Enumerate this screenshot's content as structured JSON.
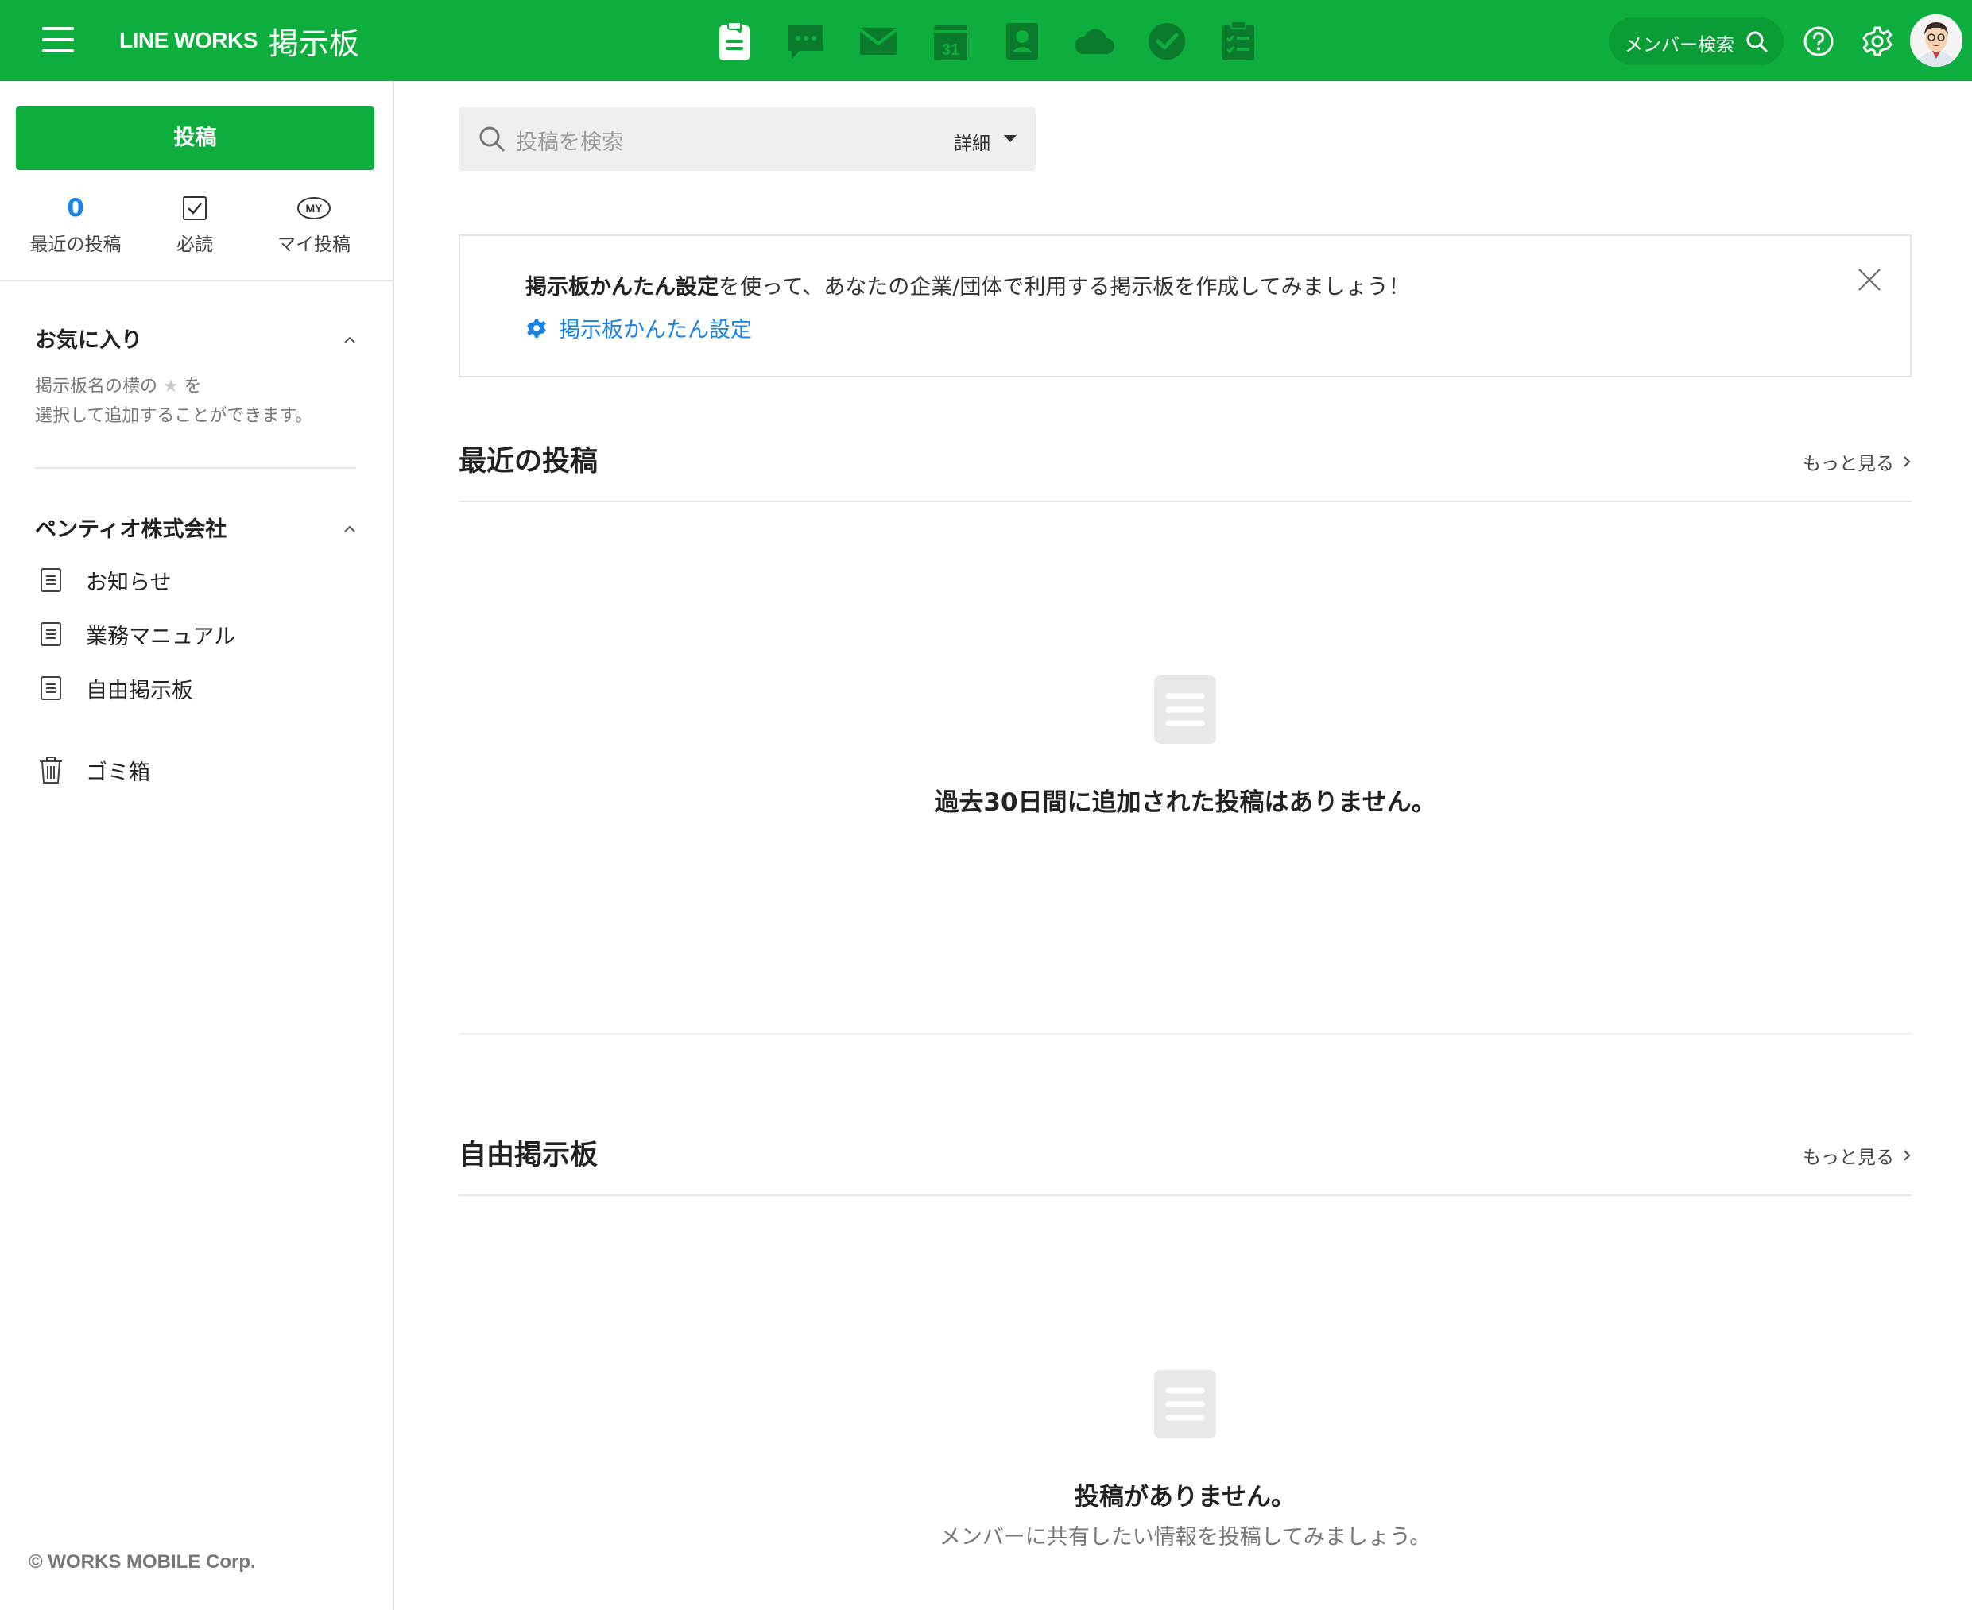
{
  "header": {
    "logo": "LINE WORKS",
    "app_name": "掲示板",
    "member_search_label": "メンバー検索",
    "calendar_day": "31",
    "apps": [
      "board-icon",
      "talk-icon",
      "mail-icon",
      "calendar-icon",
      "contacts-icon",
      "drive-icon",
      "task-icon",
      "survey-icon"
    ]
  },
  "sidebar": {
    "post_button": "投稿",
    "quick_links": {
      "recent": {
        "count": "0",
        "label": "最近の投稿"
      },
      "required": {
        "label": "必読"
      },
      "my_posts": {
        "icon_text": "MY",
        "label": "マイ投稿"
      }
    },
    "favorites": {
      "title": "お気に入り",
      "note_prefix": "掲示板名の横の",
      "note_star": "★",
      "note_suffix": "を",
      "note_line2": "選択して追加することができます。"
    },
    "company": {
      "title": "ペンティオ株式会社",
      "boards": [
        "お知らせ",
        "業務マニュアル",
        "自由掲示板"
      ]
    },
    "trash": "ゴミ箱",
    "copyright": "© WORKS MOBILE Corp."
  },
  "main": {
    "search": {
      "placeholder": "投稿を検索",
      "detail_label": "詳細"
    },
    "banner": {
      "bold_text": "掲示板かんたん設定",
      "rest_text": "を使って、あなたの企業/団体で利用する掲示板を作成してみましょう！",
      "link_text": "掲示板かんたん設定"
    },
    "recent_section": {
      "title": "最近の投稿",
      "more": "もっと見る",
      "empty_message": "過去30日間に追加された投稿はありません。"
    },
    "free_board_section": {
      "title": "自由掲示板",
      "more": "もっと見る",
      "empty_message": "投稿がありません。",
      "empty_sub": "メンバーに共有したい情報を投稿してみましょう。"
    }
  },
  "colors": {
    "brand_green": "#0dae3d",
    "link_blue": "#1a84e6",
    "app_icon_dark": "#0a7a2c"
  }
}
